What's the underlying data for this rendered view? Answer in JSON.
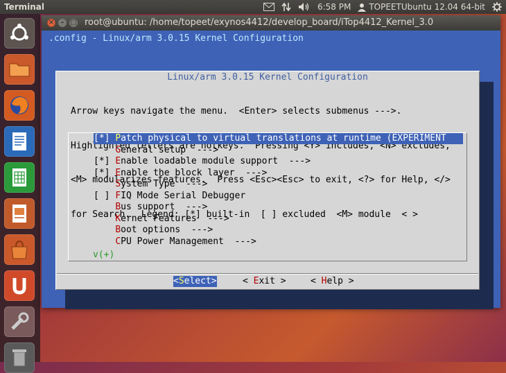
{
  "top_panel": {
    "app_title": "Terminal",
    "clock": "6:58 PM",
    "user": "TOPEETUbuntu 12.04 64-bit",
    "icons": [
      "mail-icon",
      "network-arrows-icon",
      "volume-icon",
      "user-icon",
      "gear-icon"
    ]
  },
  "launcher": {
    "items": [
      {
        "name": "ubuntu-dash-icon",
        "color": "#5d5450"
      },
      {
        "name": "files-folder-icon",
        "color": "#c9582a"
      },
      {
        "name": "firefox-icon",
        "color": "#d35a20"
      },
      {
        "name": "libreoffice-writer-icon",
        "color": "#2a6ab8"
      },
      {
        "name": "libreoffice-calc-icon",
        "color": "#2a9a3a"
      },
      {
        "name": "libreoffice-impress-icon",
        "color": "#c05a2a"
      },
      {
        "name": "software-center-icon",
        "color": "#c9582a"
      },
      {
        "name": "ubuntu-one-icon",
        "color": "#d04a2a"
      },
      {
        "name": "system-settings-icon",
        "color": "#7a5a5a"
      },
      {
        "name": "trash-icon",
        "color": "#5a5a5a"
      }
    ]
  },
  "window": {
    "title": "root@ubuntu: /home/topeet/exynos4412/develop_board/iTop4412_Kernel_3.0"
  },
  "terminal": {
    "header": ".config - Linux/arm 3.0.15 Kernel Configuration",
    "dialog_title": "Linux/arm 3.0.15 Kernel Configuration",
    "help_lines": [
      "Arrow keys navigate the menu.  <Enter> selects submenus --->.",
      "Highlighted letters are hotkeys.  Pressing <Y> includes, <N> excludes,",
      "<M> modularizes features.  Press <Esc><Esc> to exit, <?> for Help, </>",
      "for Search.  Legend: [*] built-in  [ ] excluded  <M> module  < >"
    ],
    "menu": [
      {
        "prefix": "[*] ",
        "hot": "P",
        "rest": "atch physical to virtual translations at runtime (EXPERIMENT",
        "selected": true
      },
      {
        "prefix": "    ",
        "hot": "G",
        "rest": "eneral setup  --->",
        "selected": false
      },
      {
        "prefix": "[*] ",
        "hot": "E",
        "rest": "nable loadable module support  --->",
        "selected": false
      },
      {
        "prefix": "[*] ",
        "hot": "E",
        "rest": "nable the block layer  --->",
        "selected": false
      },
      {
        "prefix": "    ",
        "hot": "S",
        "rest": "ystem Type  --->",
        "selected": false
      },
      {
        "prefix": "[ ] ",
        "hot": "F",
        "rest": "IQ Mode Serial Debugger",
        "selected": false
      },
      {
        "prefix": "    ",
        "hot": "B",
        "rest": "us support  --->",
        "selected": false
      },
      {
        "prefix": "    ",
        "hot": "K",
        "rest": "ernel Features  --->",
        "selected": false
      },
      {
        "prefix": "    ",
        "hot": "B",
        "rest": "oot options  --->",
        "selected": false
      },
      {
        "prefix": "    ",
        "hot": "C",
        "rest": "PU Power Management  --->",
        "selected": false
      }
    ],
    "more_indicator": "v(+)",
    "buttons": [
      {
        "pre": "<",
        "hot": "S",
        "rest": "elect>",
        "selected": true
      },
      {
        "pre": "< ",
        "hot": "E",
        "rest": "xit >",
        "selected": false
      },
      {
        "pre": "< ",
        "hot": "H",
        "rest": "elp >",
        "selected": false
      }
    ]
  }
}
